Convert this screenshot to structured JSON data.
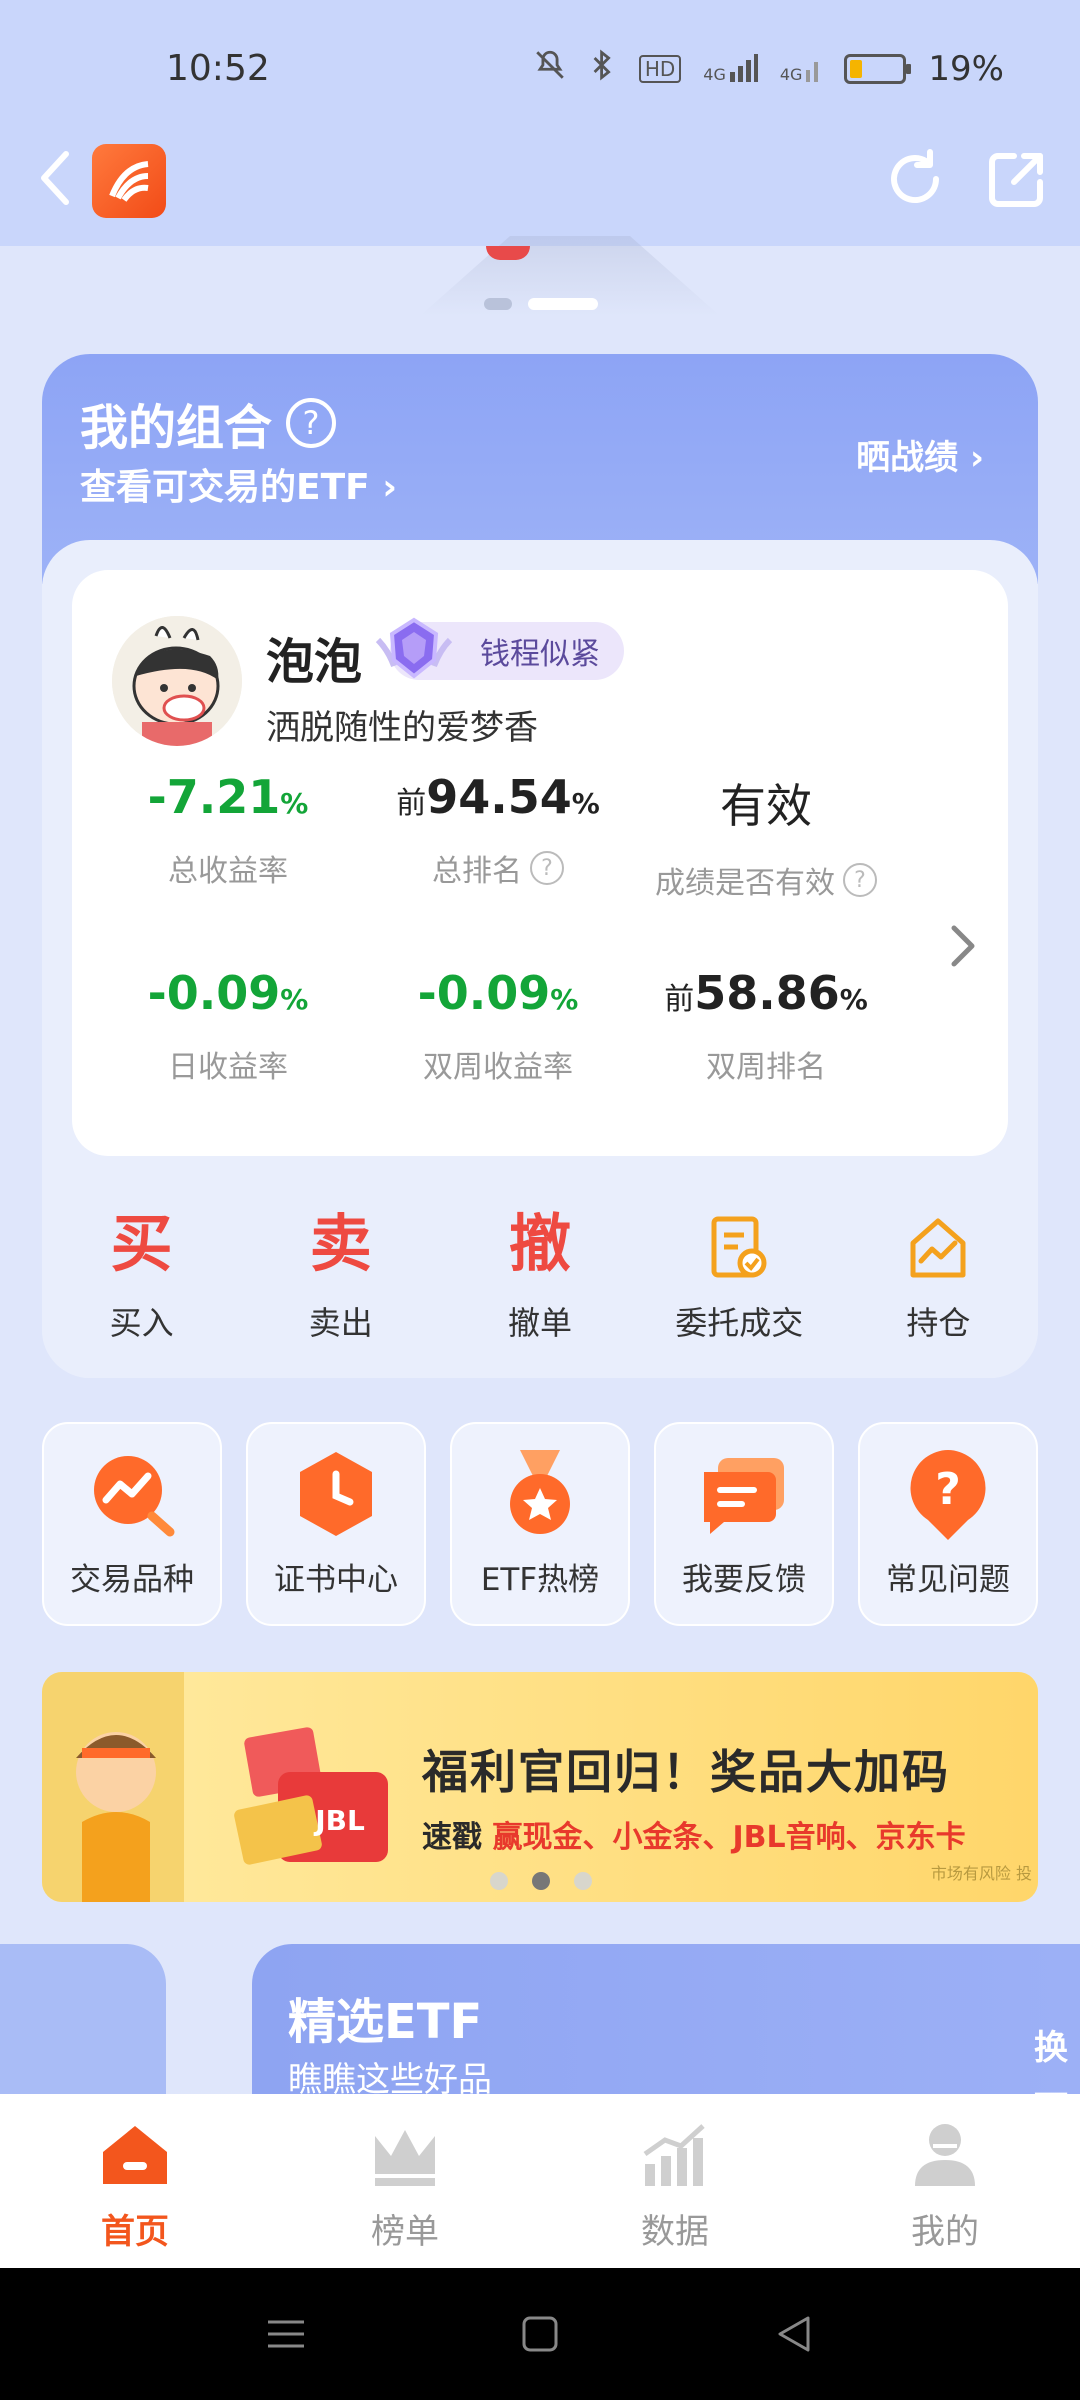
{
  "status_bar": {
    "time": "10:52",
    "battery": "19%",
    "network_a": "4G",
    "network_b": "4G",
    "hd": "HD"
  },
  "portfolio": {
    "title": "我的组合",
    "subtitle": "查看可交易的ETF",
    "share": "晒战绩",
    "user": {
      "name": "泡泡",
      "badge": "钱程似紧",
      "motto": "洒脱随性的爱梦香"
    },
    "stats": [
      {
        "value": "-7.21",
        "unit": "%",
        "label": "总收益率"
      },
      {
        "prefix": "前",
        "value": "94.54",
        "unit": "%",
        "label": "总排名"
      },
      {
        "value": "有效",
        "label": "成绩是否有效"
      },
      {
        "value": "-0.09",
        "unit": "%",
        "label": "日收益率"
      },
      {
        "value": "-0.09",
        "unit": "%",
        "label": "双周收益率"
      },
      {
        "prefix": "前",
        "value": "58.86",
        "unit": "%",
        "label": "双周排名"
      }
    ],
    "actions": [
      {
        "glyph": "买",
        "label": "买入"
      },
      {
        "glyph": "卖",
        "label": "卖出"
      },
      {
        "glyph": "撤",
        "label": "撤单"
      },
      {
        "label": "委托成交"
      },
      {
        "label": "持仓"
      }
    ]
  },
  "tiles": [
    {
      "label": "交易品种"
    },
    {
      "label": "证书中心"
    },
    {
      "label": "ETF热榜"
    },
    {
      "label": "我要反馈"
    },
    {
      "label": "常见问题"
    }
  ],
  "banner": {
    "title": "福利官回归！奖品大加码",
    "sub_prefix": "速戳 ",
    "sub_highlight": "赢现金、小金条、JBL音响、京东卡",
    "note": "市场有风险 投",
    "card_text": "JBL"
  },
  "etf": {
    "title": "精选ETF",
    "subtitle": "瞧瞧这些好品",
    "more": "换一"
  },
  "bottom_nav": [
    {
      "label": "首页",
      "active": true
    },
    {
      "label": "榜单"
    },
    {
      "label": "数据"
    },
    {
      "label": "我的"
    }
  ],
  "colors": {
    "accent": "#f3561d",
    "positive_green": "#13a538",
    "header_blue": "#8da4f5"
  }
}
